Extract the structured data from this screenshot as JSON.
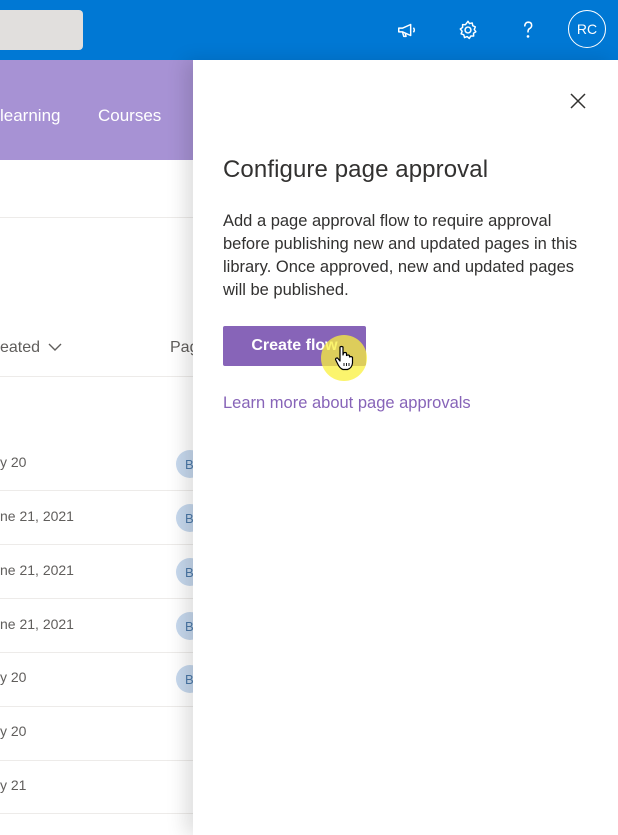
{
  "suitebar": {
    "avatar_initials": "RC",
    "icons": [
      "megaphone-icon",
      "gear-icon",
      "help-icon"
    ]
  },
  "site_nav": {
    "items": [
      "learning",
      "Courses"
    ]
  },
  "list": {
    "columns": [
      "eated",
      "Pag"
    ],
    "rows": [
      {
        "date": "y 20",
        "badge": "B"
      },
      {
        "date": "ne 21, 2021",
        "badge": "B"
      },
      {
        "date": "ne 21, 2021",
        "badge": "B"
      },
      {
        "date": "ne 21, 2021",
        "badge": "B"
      },
      {
        "date": "y 20",
        "badge": "B"
      },
      {
        "date": "y 20",
        "badge": ""
      },
      {
        "date": "y 21",
        "badge": ""
      }
    ]
  },
  "panel": {
    "title": "Configure page approval",
    "description": "Add a page approval flow to require approval before publishing new and updated pages in this library. Once approved, new and updated pages will be published.",
    "create_button": "Create flow",
    "learn_more_link": "Learn more about page approvals"
  },
  "colors": {
    "suitebar": "#0078d4",
    "site_header": "#a792d4",
    "accent": "#8764b8"
  }
}
